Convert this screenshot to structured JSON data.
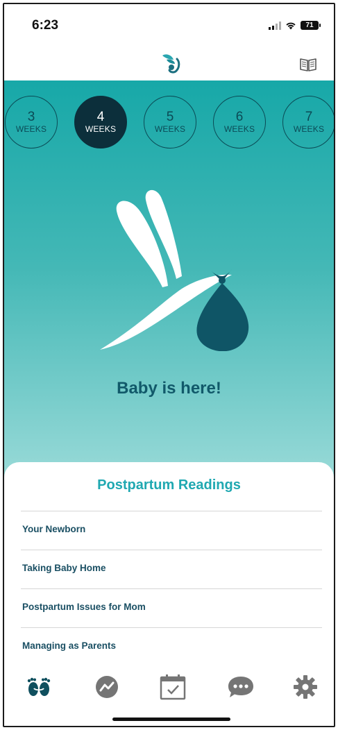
{
  "status_bar": {
    "time": "6:23",
    "battery": "71"
  },
  "header": {
    "logo_icon": "dragonfly-logo-icon",
    "book_icon": "open-book-icon"
  },
  "weeks": [
    {
      "number": "3",
      "label": "WEEKS",
      "active": false
    },
    {
      "number": "4",
      "label": "WEEKS",
      "active": true
    },
    {
      "number": "5",
      "label": "WEEKS",
      "active": false
    },
    {
      "number": "6",
      "label": "WEEKS",
      "active": false
    },
    {
      "number": "7",
      "label": "WEEKS",
      "active": false
    }
  ],
  "hero": {
    "title": "Baby is here!",
    "illustration": "dragonfly-carrying-bundle-icon"
  },
  "readings": {
    "title": "Postpartum Readings",
    "items": [
      {
        "label": "Your Newborn"
      },
      {
        "label": "Taking Baby Home"
      },
      {
        "label": "Postpartum Issues for Mom"
      },
      {
        "label": "Managing as Parents"
      }
    ]
  },
  "tab_bar": {
    "tabs": [
      {
        "icon": "baby-feet-icon",
        "active": true
      },
      {
        "icon": "trend-chart-icon",
        "active": false
      },
      {
        "icon": "calendar-check-icon",
        "active": false
      },
      {
        "icon": "chat-bubble-icon",
        "active": false
      },
      {
        "icon": "gear-icon",
        "active": false
      }
    ]
  },
  "colors": {
    "accent": "#1fa8b1",
    "dark_teal": "#0c2f3b",
    "hero_top": "#17a8a8",
    "hero_bottom": "#a4dedb",
    "tab_active": "#0f4f5e",
    "tab_inactive": "#757575"
  }
}
